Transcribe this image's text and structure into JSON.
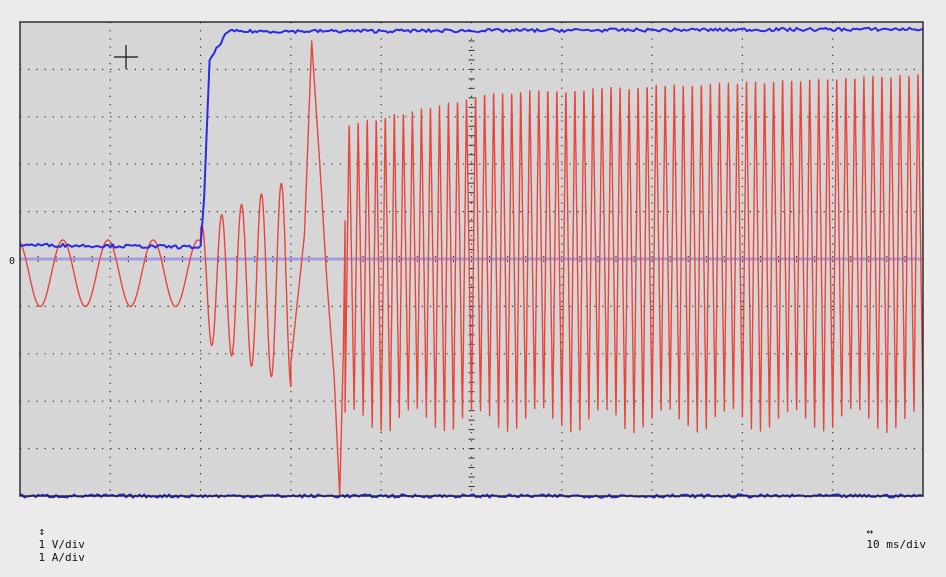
{
  "readouts": {
    "vertical_glyph": "↕",
    "voltage_scale": "1 V/div",
    "current_scale": "1 A/div",
    "time_glyph": "↔",
    "time_scale": "10 ms/div"
  },
  "markers": {
    "zero_label": "0"
  },
  "colors": {
    "screen_bg": "#d6d6d6",
    "frame_bg": "#ebebeb",
    "grid": "#333333",
    "voltage_trace": "#e8453c",
    "current_trace": "#2a2ae8",
    "zero_line": "#a79be0"
  },
  "chart_data": {
    "type": "line",
    "x_divisions": 10,
    "y_divisions": 10,
    "y_range_div": [
      -5,
      5
    ],
    "grid": true,
    "x_unit_per_div": "10 ms",
    "series": [
      {
        "unit_per_div": "1 V",
        "color": "#e8453c",
        "segments": [
          {
            "t_start_ms": 0,
            "t_end_ms": 20,
            "period_ms": 5.0,
            "amplitude_div": 0.7,
            "offset_div": -0.3
          },
          {
            "t_start_ms": 20,
            "t_end_ms": 30,
            "period_ms": 2.2,
            "amplitude_start_div": 1.2,
            "amplitude_end_div": 2.2,
            "offset_div": -0.5
          },
          {
            "t_start_ms": 31,
            "t_end_ms": 36,
            "kind": "transient",
            "peak_div": 4.6,
            "trough_div": -5.0
          },
          {
            "t_start_ms": 36,
            "t_end_ms": 100,
            "period_ms": 1.0,
            "positive_peak_start_div": 2.9,
            "positive_peak_mid_div": 3.6,
            "positive_peak_end_div": 4.0,
            "negative_peak_div": -3.4
          }
        ]
      },
      {
        "unit_per_div": "1 A",
        "color": "#2a2ae8",
        "points": [
          {
            "t_ms": 0,
            "y_div": 0.3
          },
          {
            "t_ms": 20,
            "y_div": 0.25
          },
          {
            "t_ms": 20.4,
            "y_div": 1.3
          },
          {
            "t_ms": 21.0,
            "y_div": 4.2
          },
          {
            "t_ms": 23.0,
            "y_div": 4.8
          },
          {
            "t_ms": 100,
            "y_div": 4.85
          }
        ]
      },
      {
        "unit_per_div": "1 A",
        "color": "#2a2ae8",
        "points": [
          {
            "t_ms": 0,
            "y_div": -5.0
          },
          {
            "t_ms": 100,
            "y_div": -5.0
          }
        ]
      }
    ]
  }
}
